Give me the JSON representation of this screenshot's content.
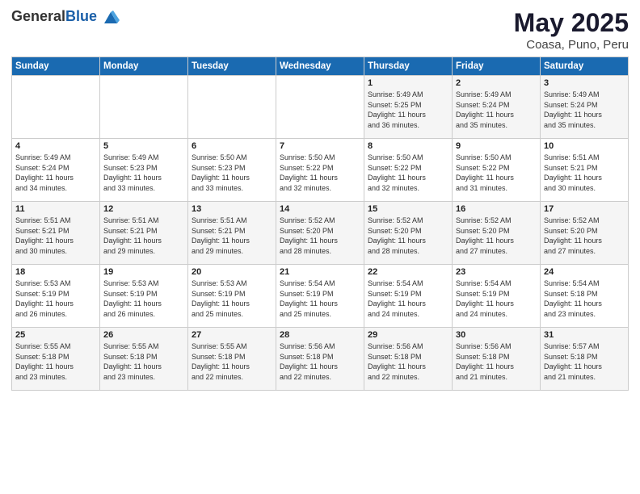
{
  "header": {
    "logo_general": "General",
    "logo_blue": "Blue",
    "title": "May 2025",
    "subtitle": "Coasa, Puno, Peru"
  },
  "days_of_week": [
    "Sunday",
    "Monday",
    "Tuesday",
    "Wednesday",
    "Thursday",
    "Friday",
    "Saturday"
  ],
  "weeks": [
    [
      {
        "day": "",
        "info": ""
      },
      {
        "day": "",
        "info": ""
      },
      {
        "day": "",
        "info": ""
      },
      {
        "day": "",
        "info": ""
      },
      {
        "day": "1",
        "info": "Sunrise: 5:49 AM\nSunset: 5:25 PM\nDaylight: 11 hours\nand 36 minutes."
      },
      {
        "day": "2",
        "info": "Sunrise: 5:49 AM\nSunset: 5:24 PM\nDaylight: 11 hours\nand 35 minutes."
      },
      {
        "day": "3",
        "info": "Sunrise: 5:49 AM\nSunset: 5:24 PM\nDaylight: 11 hours\nand 35 minutes."
      }
    ],
    [
      {
        "day": "4",
        "info": "Sunrise: 5:49 AM\nSunset: 5:24 PM\nDaylight: 11 hours\nand 34 minutes."
      },
      {
        "day": "5",
        "info": "Sunrise: 5:49 AM\nSunset: 5:23 PM\nDaylight: 11 hours\nand 33 minutes."
      },
      {
        "day": "6",
        "info": "Sunrise: 5:50 AM\nSunset: 5:23 PM\nDaylight: 11 hours\nand 33 minutes."
      },
      {
        "day": "7",
        "info": "Sunrise: 5:50 AM\nSunset: 5:22 PM\nDaylight: 11 hours\nand 32 minutes."
      },
      {
        "day": "8",
        "info": "Sunrise: 5:50 AM\nSunset: 5:22 PM\nDaylight: 11 hours\nand 32 minutes."
      },
      {
        "day": "9",
        "info": "Sunrise: 5:50 AM\nSunset: 5:22 PM\nDaylight: 11 hours\nand 31 minutes."
      },
      {
        "day": "10",
        "info": "Sunrise: 5:51 AM\nSunset: 5:21 PM\nDaylight: 11 hours\nand 30 minutes."
      }
    ],
    [
      {
        "day": "11",
        "info": "Sunrise: 5:51 AM\nSunset: 5:21 PM\nDaylight: 11 hours\nand 30 minutes."
      },
      {
        "day": "12",
        "info": "Sunrise: 5:51 AM\nSunset: 5:21 PM\nDaylight: 11 hours\nand 29 minutes."
      },
      {
        "day": "13",
        "info": "Sunrise: 5:51 AM\nSunset: 5:21 PM\nDaylight: 11 hours\nand 29 minutes."
      },
      {
        "day": "14",
        "info": "Sunrise: 5:52 AM\nSunset: 5:20 PM\nDaylight: 11 hours\nand 28 minutes."
      },
      {
        "day": "15",
        "info": "Sunrise: 5:52 AM\nSunset: 5:20 PM\nDaylight: 11 hours\nand 28 minutes."
      },
      {
        "day": "16",
        "info": "Sunrise: 5:52 AM\nSunset: 5:20 PM\nDaylight: 11 hours\nand 27 minutes."
      },
      {
        "day": "17",
        "info": "Sunrise: 5:52 AM\nSunset: 5:20 PM\nDaylight: 11 hours\nand 27 minutes."
      }
    ],
    [
      {
        "day": "18",
        "info": "Sunrise: 5:53 AM\nSunset: 5:19 PM\nDaylight: 11 hours\nand 26 minutes."
      },
      {
        "day": "19",
        "info": "Sunrise: 5:53 AM\nSunset: 5:19 PM\nDaylight: 11 hours\nand 26 minutes."
      },
      {
        "day": "20",
        "info": "Sunrise: 5:53 AM\nSunset: 5:19 PM\nDaylight: 11 hours\nand 25 minutes."
      },
      {
        "day": "21",
        "info": "Sunrise: 5:54 AM\nSunset: 5:19 PM\nDaylight: 11 hours\nand 25 minutes."
      },
      {
        "day": "22",
        "info": "Sunrise: 5:54 AM\nSunset: 5:19 PM\nDaylight: 11 hours\nand 24 minutes."
      },
      {
        "day": "23",
        "info": "Sunrise: 5:54 AM\nSunset: 5:19 PM\nDaylight: 11 hours\nand 24 minutes."
      },
      {
        "day": "24",
        "info": "Sunrise: 5:54 AM\nSunset: 5:18 PM\nDaylight: 11 hours\nand 23 minutes."
      }
    ],
    [
      {
        "day": "25",
        "info": "Sunrise: 5:55 AM\nSunset: 5:18 PM\nDaylight: 11 hours\nand 23 minutes."
      },
      {
        "day": "26",
        "info": "Sunrise: 5:55 AM\nSunset: 5:18 PM\nDaylight: 11 hours\nand 23 minutes."
      },
      {
        "day": "27",
        "info": "Sunrise: 5:55 AM\nSunset: 5:18 PM\nDaylight: 11 hours\nand 22 minutes."
      },
      {
        "day": "28",
        "info": "Sunrise: 5:56 AM\nSunset: 5:18 PM\nDaylight: 11 hours\nand 22 minutes."
      },
      {
        "day": "29",
        "info": "Sunrise: 5:56 AM\nSunset: 5:18 PM\nDaylight: 11 hours\nand 22 minutes."
      },
      {
        "day": "30",
        "info": "Sunrise: 5:56 AM\nSunset: 5:18 PM\nDaylight: 11 hours\nand 21 minutes."
      },
      {
        "day": "31",
        "info": "Sunrise: 5:57 AM\nSunset: 5:18 PM\nDaylight: 11 hours\nand 21 minutes."
      }
    ]
  ]
}
